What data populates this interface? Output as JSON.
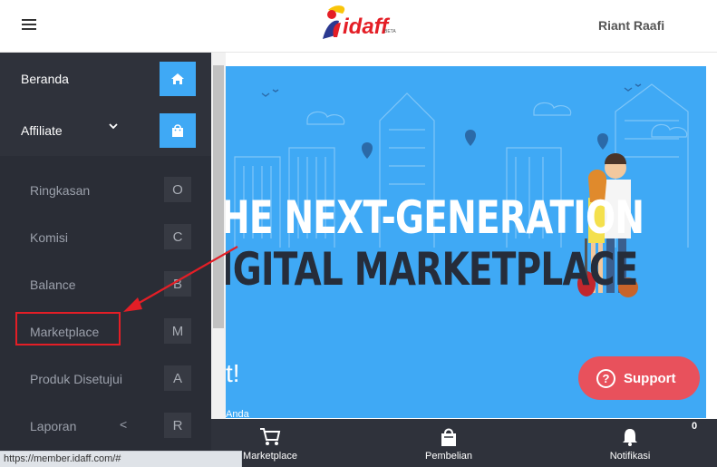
{
  "header": {
    "username": "Riant Raafi",
    "logo_text": "idaff",
    "logo_badge": "BETA",
    "colors": {
      "logo_red": "#e41e26",
      "logo_blue": "#2b3990",
      "logo_yellow": "#f9c50a"
    }
  },
  "sidebar": {
    "main_items": [
      {
        "label": "Beranda",
        "icon": "home-icon"
      },
      {
        "label": "Affiliate",
        "icon": "shopping-bag-icon",
        "expanded": true
      }
    ],
    "sub_items": [
      {
        "label": "Ringkasan",
        "key": "O"
      },
      {
        "label": "Komisi",
        "key": "C"
      },
      {
        "label": "Balance",
        "key": "B"
      },
      {
        "label": "Marketplace",
        "key": "M",
        "highlighted": true
      },
      {
        "label": "Produk Disetujui",
        "key": "A"
      },
      {
        "label": "Laporan",
        "key": "R",
        "submenu_indicator": "<"
      }
    ]
  },
  "banner": {
    "headline_line1": "HE NEXT-GENERATION",
    "headline_line2": "IGITAL MARKETPLACE",
    "partial_text": "t!",
    "partial_subtext": "Anda"
  },
  "support_button": {
    "label": "Support",
    "color": "#e8515c"
  },
  "bottom_nav": {
    "items": [
      {
        "label": "Marketplace",
        "icon": "cart-icon"
      },
      {
        "label": "Pembelian",
        "icon": "shopping-bag-icon"
      },
      {
        "label": "Notifikasi",
        "icon": "bell-icon"
      }
    ],
    "notification_count": "0"
  },
  "status_bar": {
    "url": "https://member.idaff.com/#"
  },
  "colors": {
    "sidebar_bg": "#2a2d36",
    "accent_blue": "#3fa9f5",
    "annotation_red": "#e41e26",
    "banner_bg": "#3fa9f5"
  }
}
